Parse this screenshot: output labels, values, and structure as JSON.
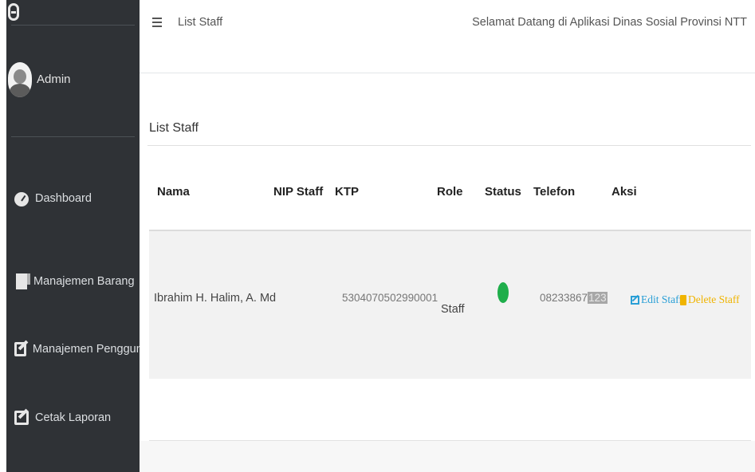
{
  "sidebar": {
    "user_name": "Admin",
    "items": [
      {
        "label": "Dashboard",
        "icon": "dashboard-icon"
      },
      {
        "label": "Manajemen Barang",
        "icon": "document-icon"
      },
      {
        "label": "Manajemen Pengguna Aplik",
        "icon": "edit-icon"
      },
      {
        "label": "Cetak Laporan",
        "icon": "edit-icon"
      }
    ]
  },
  "topbar": {
    "title": "List Staff",
    "welcome": "Selamat Datang di Aplikasi Dinas Sosial Provinsi NTT"
  },
  "main": {
    "panel_title": "List Staff",
    "columns": [
      "Nama",
      "NIP Staff",
      "KTP",
      "Role",
      "Status",
      "Telefon",
      "Aksi"
    ],
    "rows": [
      {
        "nama": "Ibrahim H. Halim, A. Md",
        "nip": "",
        "ktp": "5304070502990001",
        "role": "Staff",
        "status_color": "#1fae4b",
        "telefon_visible": "08233867",
        "telefon_masked": "123",
        "edit_label": "Edit Staff",
        "delete_label": "Delete Staff"
      }
    ]
  },
  "colors": {
    "sidebar_bg": "#2f3236",
    "edit": "#2a9fd6",
    "delete": "#f0b400",
    "status_active": "#1fae4b"
  }
}
